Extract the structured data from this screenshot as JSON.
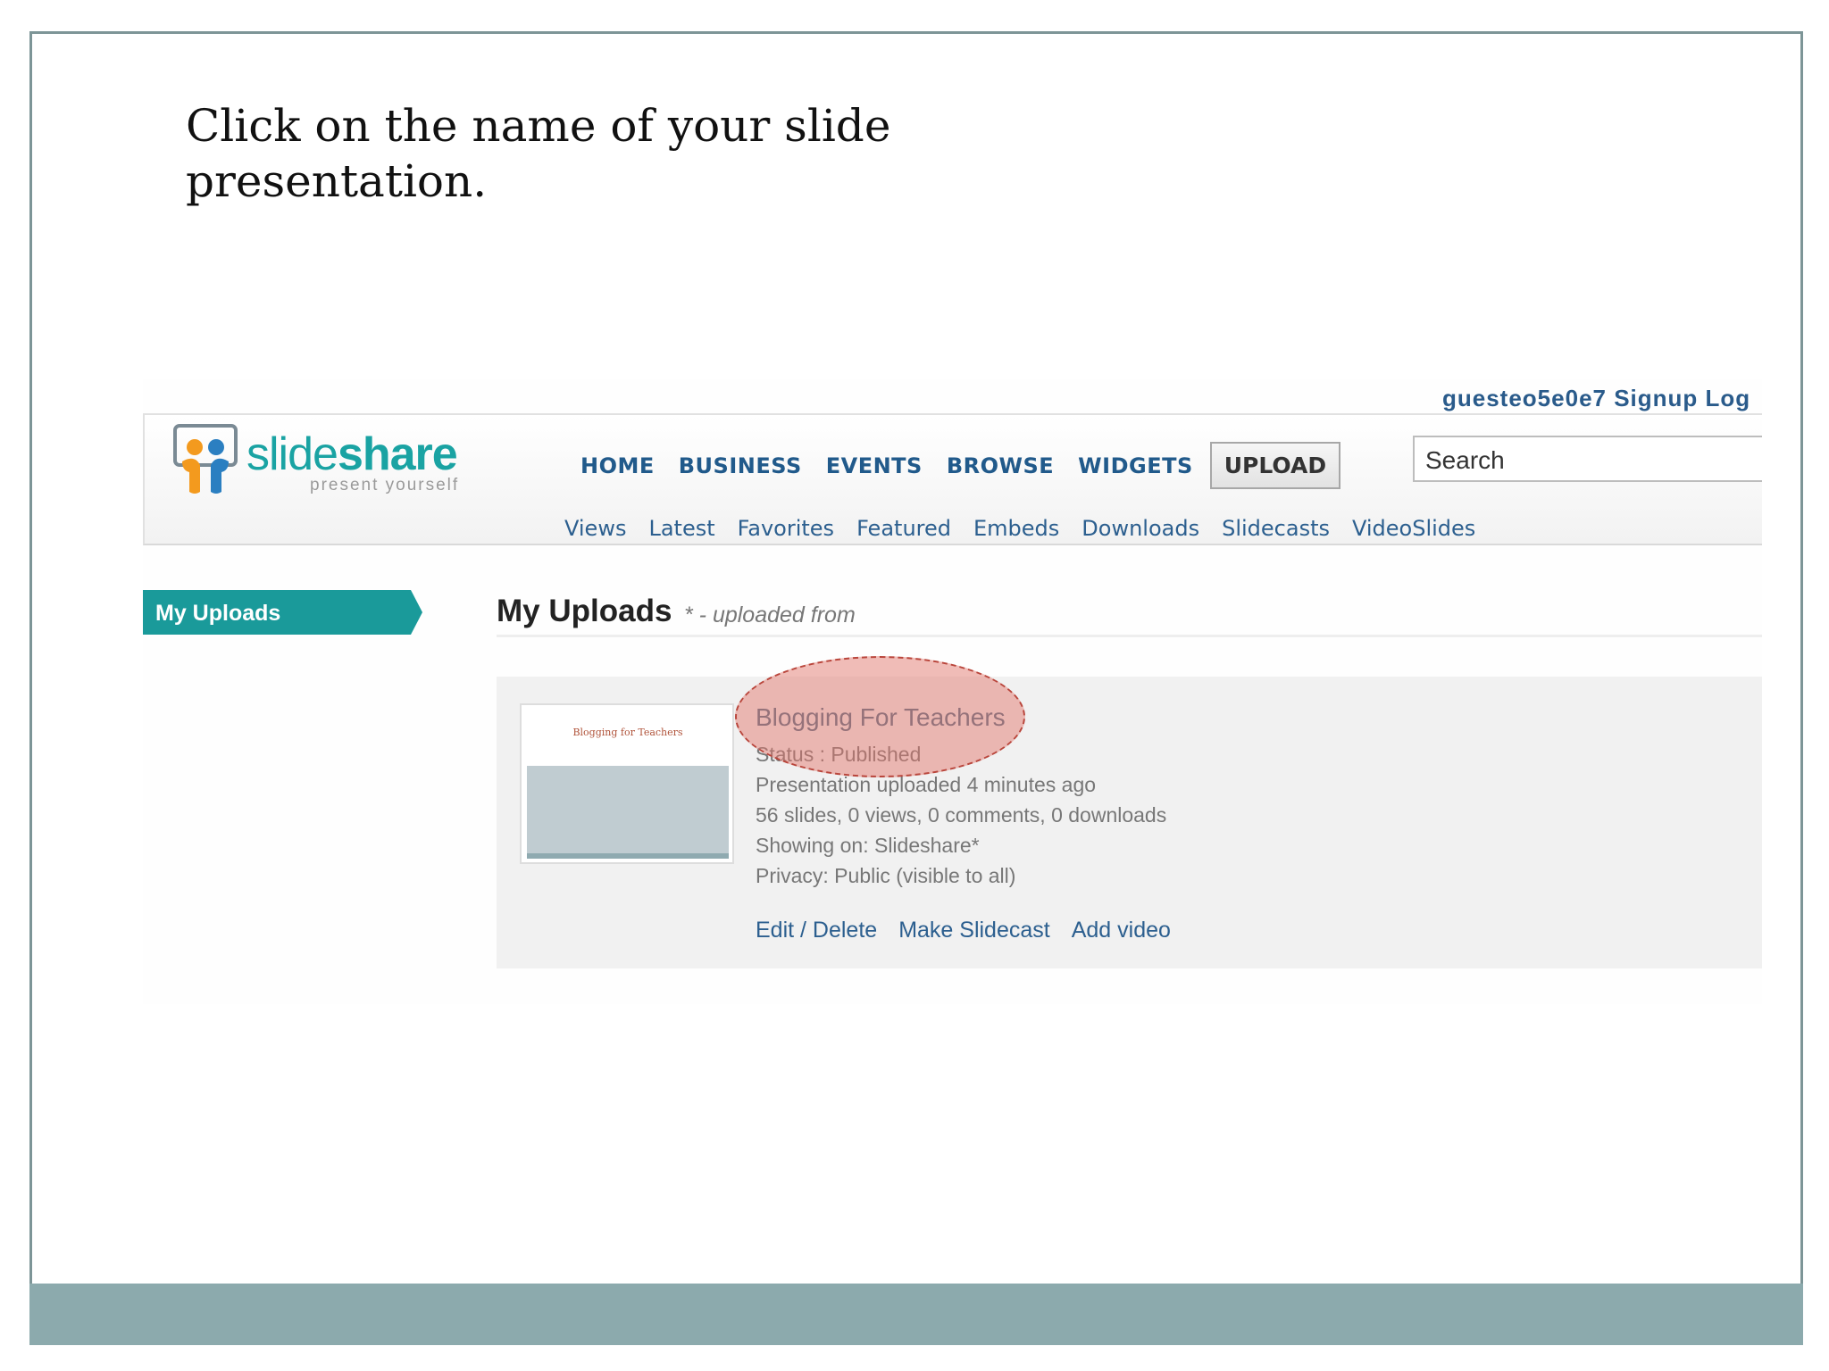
{
  "instruction": {
    "line1": "Click on the name of your slide",
    "line2": "presentation."
  },
  "screenshot": {
    "top_links": "guesteo5e0e7  Signup  Log",
    "logo": {
      "word_light": "slide",
      "word_bold": "share",
      "tagline": "present yourself"
    },
    "main_nav": [
      "HOME",
      "BUSINESS",
      "EVENTS",
      "BROWSE",
      "WIDGETS"
    ],
    "upload_label": "UPLOAD",
    "search_placeholder": "Search",
    "sub_nav": [
      "Views",
      "Latest",
      "Favorites",
      "Featured",
      "Embeds",
      "Downloads",
      "Slidecasts",
      "VideoSlides"
    ],
    "side_tab": "My Uploads",
    "page_heading": "My Uploads",
    "page_subheading": "* - uploaded from",
    "upload_item": {
      "thumb_title": "Blogging for Teachers",
      "title": "Blogging For Teachers",
      "status": "Status : Published",
      "uploaded": "Presentation uploaded 4 minutes ago",
      "stats": "56 slides, 0 views, 0 comments, 0 downloads",
      "showing": "Showing on: Slideshare*",
      "privacy": "Privacy: Public (visible to all)",
      "actions": [
        "Edit / Delete",
        "Make Slidecast",
        "Add video"
      ]
    }
  },
  "colors": {
    "frame_border": "#7d9597",
    "footer_band": "#8caaad",
    "brand_teal": "#1aa3a3",
    "nav_blue": "#215a8b",
    "highlight": "#e2766a"
  }
}
